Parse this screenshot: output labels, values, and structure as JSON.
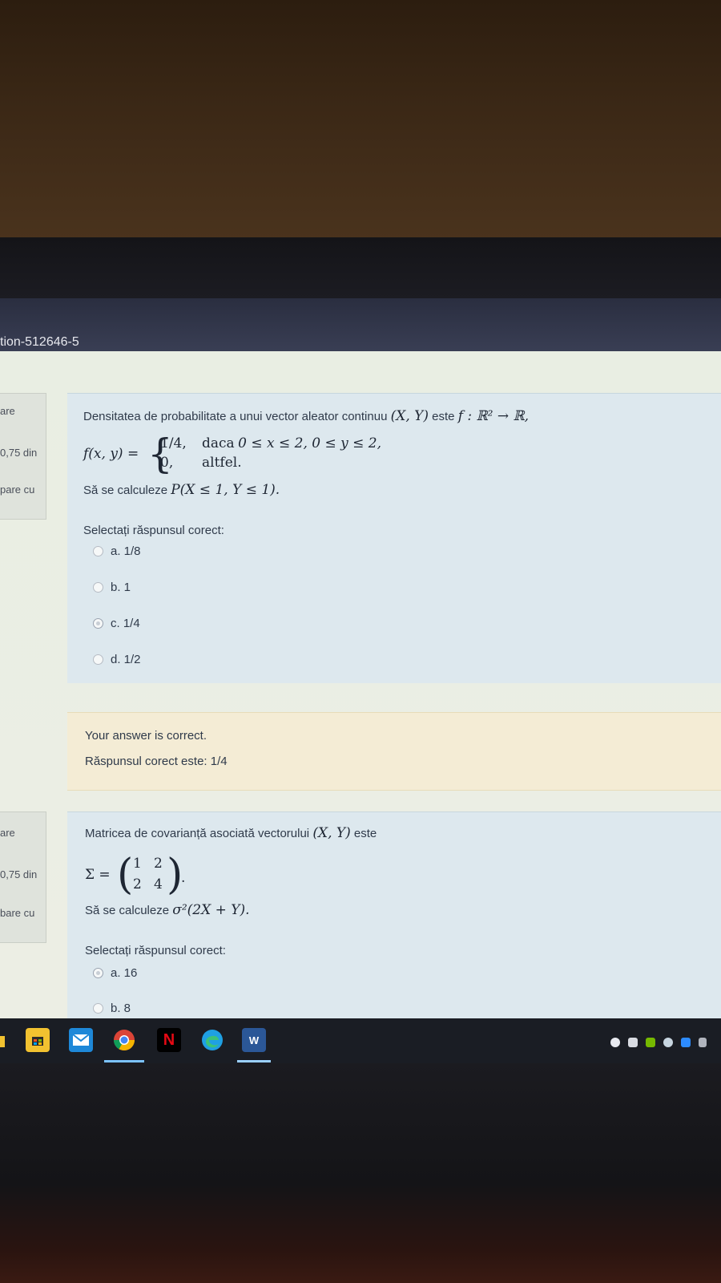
{
  "browser": {
    "tab_title": "tion-512646-5"
  },
  "question1": {
    "side_info": [
      "are",
      "0,75 din",
      "pare cu"
    ],
    "intro": "Densitatea de probabilitate a unui vector aleator continuu",
    "vector": "(X, Y)",
    "este": "este",
    "mapping": "f : ℝ² → ℝ,",
    "f_label": "f(x, y) =",
    "case1_value": "1/4,",
    "case1_cond_word": "daca",
    "case1_cond": "0 ≤ x ≤ 2,  0 ≤ y ≤ 2,",
    "case2_value": "0,",
    "case2_cond": "altfel.",
    "task": "Să se calculeze",
    "task_expr": "P(X ≤ 1, Y ≤ 1).",
    "prompt": "Selectați răspunsul corect:",
    "options": [
      {
        "label": "a. 1/8",
        "selected": false
      },
      {
        "label": "b. 1",
        "selected": false
      },
      {
        "label": "c. 1/4",
        "selected": true
      },
      {
        "label": "d. 1/2",
        "selected": false
      }
    ]
  },
  "feedback1": {
    "result": "Your answer is correct.",
    "correct": "Răspunsul corect este: 1/4"
  },
  "question2": {
    "side_info": [
      "are",
      "0,75 din",
      "bare cu"
    ],
    "intro": "Matricea de covarianță asociată vectorului",
    "vector": "(X, Y)",
    "este": "este",
    "sigma": "Σ =",
    "matrix": [
      [
        "1",
        "2"
      ],
      [
        "2",
        "4"
      ]
    ],
    "period": ".",
    "task": "Să se calculeze",
    "task_expr": "σ²(2X + Y).",
    "prompt": "Selectați răspunsul corect:",
    "options": [
      {
        "label": "a. 16",
        "selected": true
      },
      {
        "label": "b. 8",
        "selected": false
      }
    ]
  },
  "taskbar": {
    "icons": [
      "file-explorer-icon",
      "store-icon",
      "mail-icon",
      "chrome-icon",
      "netflix-icon",
      "edge-icon",
      "word-icon"
    ],
    "netflix_letter": "N",
    "word_letter": "W"
  },
  "colors": {
    "panel": "#dde8ee",
    "feedback": "#f4ecd5",
    "text": "#2f3a4a"
  }
}
